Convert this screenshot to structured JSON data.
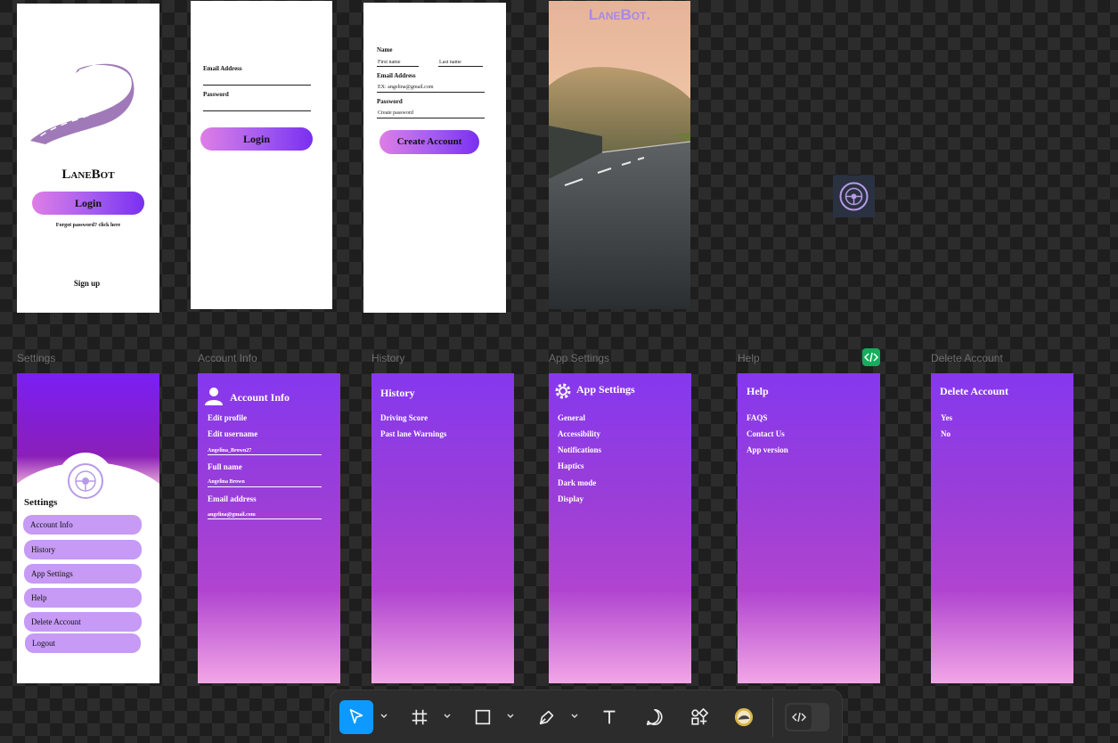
{
  "frame_labels": {
    "settings": "Settings",
    "account_info": "Account Info",
    "history": "History",
    "app_settings": "App Settings",
    "help": "Help",
    "delete_account": "Delete Account"
  },
  "welcome": {
    "brand": "LaneBot",
    "login_button": "Login",
    "forgot": "Forgot password? click here",
    "signup": "Sign up"
  },
  "login": {
    "email_label": "Email Address",
    "password_label": "Password",
    "login_button": "Login"
  },
  "signup": {
    "name_label": "Name",
    "first_placeholder": "First name",
    "last_placeholder": "Last name",
    "email_label": "Email Address",
    "email_placeholder": "EX: angelina@gmail.com",
    "password_label": "Password",
    "password_placeholder": "Create password",
    "create_button": "Create Account"
  },
  "splash": {
    "brand": "LaneBot."
  },
  "settings_screen": {
    "title": "Settings",
    "items": [
      "Account Info",
      "History",
      "App Settings",
      "Help",
      "Delete Account",
      "Logout"
    ]
  },
  "account_screen": {
    "title": "Account Info",
    "edit_profile": "Edit profile",
    "edit_username": "Edit username",
    "username_value": "Angelina_Brown27",
    "full_name_label": "Full name",
    "full_name_value": "Angelina Brown",
    "email_label": "Email address",
    "email_value": "angelina@gmail.com"
  },
  "history_screen": {
    "title": "History",
    "items": [
      "Driving Score",
      "Past lane Warnings"
    ]
  },
  "app_settings_screen": {
    "title": "App Settings",
    "items": [
      "General",
      "Accessibility",
      "Notifications",
      "Haptics",
      "Dark mode",
      "Display"
    ]
  },
  "help_screen": {
    "title": "Help",
    "items": [
      "FAQS",
      "Contact Us",
      "App version"
    ]
  },
  "delete_screen": {
    "title": "Delete Account",
    "items": [
      "Yes",
      "No"
    ]
  },
  "toolbar": {
    "tools": [
      "move-tool",
      "frame-tool",
      "rectangle-tool",
      "pen-tool",
      "text-tool",
      "comment-tool",
      "assets-tool",
      "plugin-tool",
      "dev-mode-toggle"
    ]
  },
  "colors": {
    "canvas": "#1e1e1e",
    "accent_blue": "#0d99ff",
    "purple_top": "#8638ee",
    "purple_bottom": "#f2a6e6",
    "menu_item": "#c69af5",
    "dev_green": "#14ae5c"
  }
}
